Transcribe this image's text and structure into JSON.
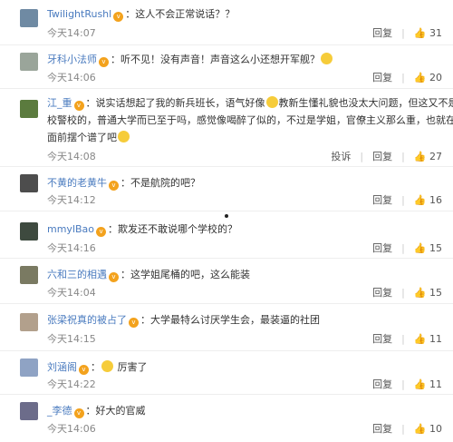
{
  "colors": {
    "username": "#4a7bbf",
    "vip_badge": "#f3a21d",
    "divider": "#eeeeee"
  },
  "icons": {
    "vip": "vip-badge-icon",
    "like": "thumbs-up-icon",
    "emoji": "smiley-emoji-icon"
  },
  "comments": [
    {
      "user": "TwilightRushl",
      "text": "这人不会正常说话？？",
      "time": "今天14:07",
      "reply": "回复",
      "likes": "31"
    },
    {
      "user": "牙科小法师",
      "text": "听不见！没有声音！声音这么小还想开军舰？",
      "time": "今天14:06",
      "reply": "回复",
      "likes": "20"
    },
    {
      "user": "江_重",
      "text_line1": "说实话想起了我的新兵班长，语气好像",
      "text_line1b": "教新生懂礼貌也没太大问题，但这又不是军",
      "text_line2": "校警校的，普通大学而已至于吗，感觉像喝醉了似的，不过是学姐，官僚主义那么重，也就在新生",
      "text_line3": "面前摆个谱了吧",
      "time": "今天14:08",
      "report": "投诉",
      "reply": "回复",
      "likes": "27"
    },
    {
      "user": "不黄的老黄牛",
      "text": "不是航院的吧？",
      "time": "今天14:12",
      "reply": "回复",
      "likes": "16"
    },
    {
      "user": "mmylBao",
      "text": "欺发还不敢说哪个学校的？",
      "time": "今天14:16",
      "reply": "回复",
      "likes": "15"
    },
    {
      "user": "六和三的相遇",
      "text": "这学姐尾桶的吧，这么能装",
      "time": "今天14:04",
      "reply": "回复",
      "likes": "15"
    },
    {
      "user": "张梁祝真的被占了",
      "text": "大学最特么讨厌学生会，最装逼的社团",
      "time": "今天14:15",
      "reply": "回复",
      "likes": "11"
    },
    {
      "user": "刘涵阁",
      "text": "厉害了",
      "time": "今天14:22",
      "reply": "回复",
      "likes": "11"
    },
    {
      "user": "_李德",
      "text": "好大的官威",
      "time": "今天14:06",
      "reply": "回复",
      "likes": "10"
    }
  ]
}
